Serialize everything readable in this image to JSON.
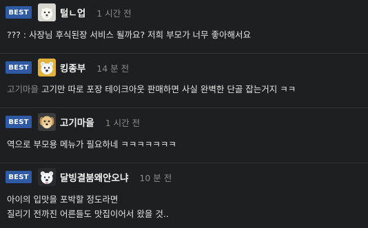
{
  "badge_label": "BEST",
  "comments": [
    {
      "nickname": "털ㄴ업",
      "time": "1 시간 전",
      "avatar_icon": "white-dog-avatar",
      "mention": "",
      "lines": [
        "??? : 사장님 후식된장 서비스 될까요? 저희 부모가 너무 좋아해서요"
      ]
    },
    {
      "nickname": "킹종부",
      "time": "14 분 전",
      "avatar_icon": "polar-bear-avatar",
      "mention": "고기마을",
      "lines": [
        "고기만 따로 포장 테이크아웃 판매하면 사실 완벽한 단골 잡는거지 ㅋㅋ"
      ]
    },
    {
      "nickname": "고기마을",
      "time": "1 시간 전",
      "avatar_icon": "puppy-avatar",
      "mention": "",
      "lines": [
        "역으로 부모용 메뉴가 필요하네 ㅋㅋㅋㅋㅋㅋㅋ"
      ]
    },
    {
      "nickname": "달빙결붐왜안오냐",
      "time": "10 분 전",
      "avatar_icon": "polar-bear-avatar",
      "mention": "",
      "lines": [
        "아이의 입맛을 포박할 정도라면",
        "질리기 전까진 어른들도 맛집이어서 왔을 것.."
      ]
    }
  ],
  "colors": {
    "background": "#1e1f22",
    "best_badge": "#2f5aa6",
    "divider": "#34363b",
    "time_text": "#8a8c91"
  }
}
